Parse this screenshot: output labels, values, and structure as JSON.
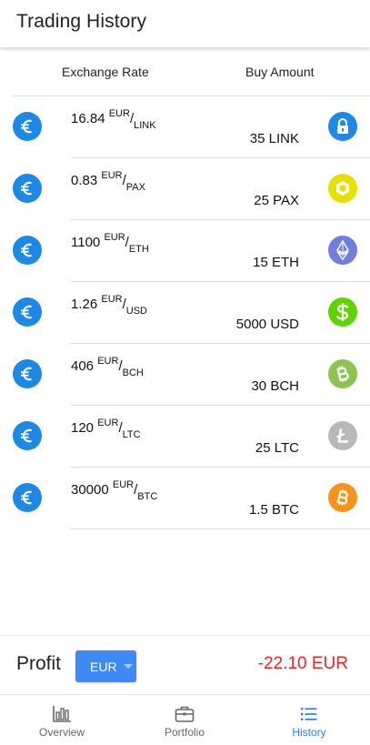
{
  "header": {
    "title": "Trading History"
  },
  "columns": {
    "rate": "Exchange Rate",
    "buy": "Buy Amount"
  },
  "colors": {
    "euro": "#1e88e5",
    "link": "#1e88e5",
    "pax": "#e8e000",
    "eth": "#6f7fe0",
    "usd": "#5ed300",
    "bch": "#8dc351",
    "ltc": "#b8b8b8",
    "btc": "#f7931a",
    "profit_negative": "#e3262d",
    "accent": "#2f7df6"
  },
  "trades": [
    {
      "rate": "16.84",
      "base": "EUR",
      "quote": "LINK",
      "amount": "35 LINK",
      "icon": "chainlink-icon"
    },
    {
      "rate": "0.83",
      "base": "EUR",
      "quote": "PAX",
      "amount": "25 PAX",
      "icon": "paxos-icon"
    },
    {
      "rate": "1100",
      "base": "EUR",
      "quote": "ETH",
      "amount": "15 ETH",
      "icon": "ethereum-icon"
    },
    {
      "rate": "1.26",
      "base": "EUR",
      "quote": "USD",
      "amount": "5000 USD",
      "icon": "dollar-icon"
    },
    {
      "rate": "406",
      "base": "EUR",
      "quote": "BCH",
      "amount": "30 BCH",
      "icon": "bitcoin-cash-icon"
    },
    {
      "rate": "120",
      "base": "EUR",
      "quote": "LTC",
      "amount": "25 LTC",
      "icon": "litecoin-icon"
    },
    {
      "rate": "30000",
      "base": "EUR",
      "quote": "BTC",
      "amount": "1.5 BTC",
      "icon": "bitcoin-icon"
    }
  ],
  "profit": {
    "label": "Profit",
    "currency": "EUR",
    "value": "-22.10 EUR"
  },
  "nav": {
    "overview": "Overview",
    "portfolio": "Portfolio",
    "history": "History",
    "active": "history"
  }
}
